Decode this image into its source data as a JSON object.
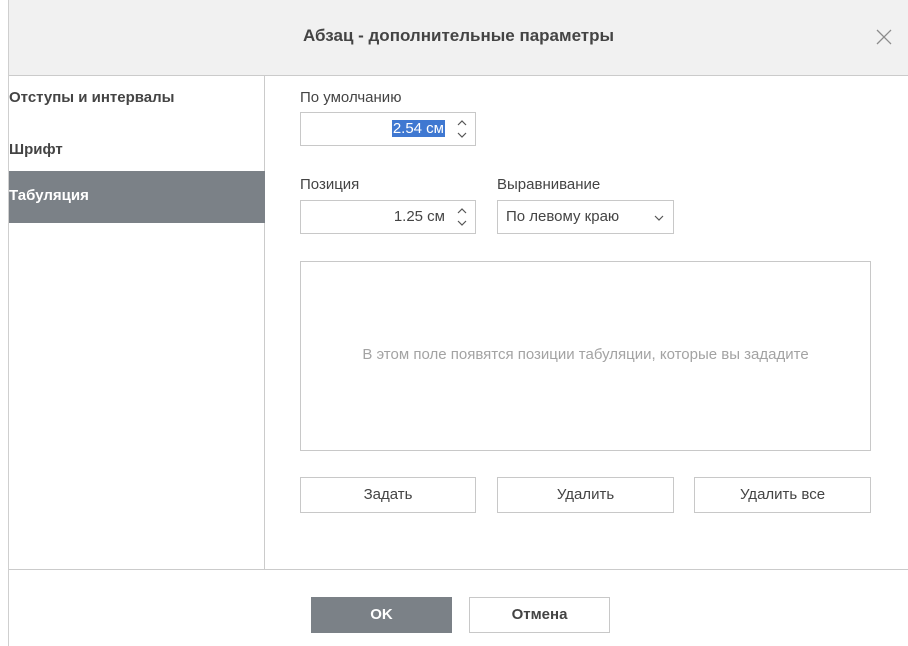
{
  "dialog": {
    "title": "Абзац - дополнительные параметры",
    "close_icon": "close-icon"
  },
  "sidebar": {
    "items": [
      {
        "label": "Отступы и интервалы",
        "selected": false
      },
      {
        "label": "Шрифт",
        "selected": false
      },
      {
        "label": "Табуляция",
        "selected": true
      }
    ]
  },
  "tabs_panel": {
    "default_label": "По умолчанию",
    "default_value": "2.54 см",
    "position_label": "Позиция",
    "position_value": "1.25 см",
    "alignment_label": "Выравнивание",
    "alignment_value": "По левому краю",
    "list_placeholder": "В этом поле появятся позиции табуляции, которые вы зададите",
    "set_button": "Задать",
    "remove_button": "Удалить",
    "remove_all_button": "Удалить все"
  },
  "footer": {
    "ok_label": "OK",
    "cancel_label": "Отмена"
  },
  "colors": {
    "selected_bg": "#7b8187",
    "header_bg": "#f1f1f1",
    "selection_highlight": "#3f78d1"
  }
}
